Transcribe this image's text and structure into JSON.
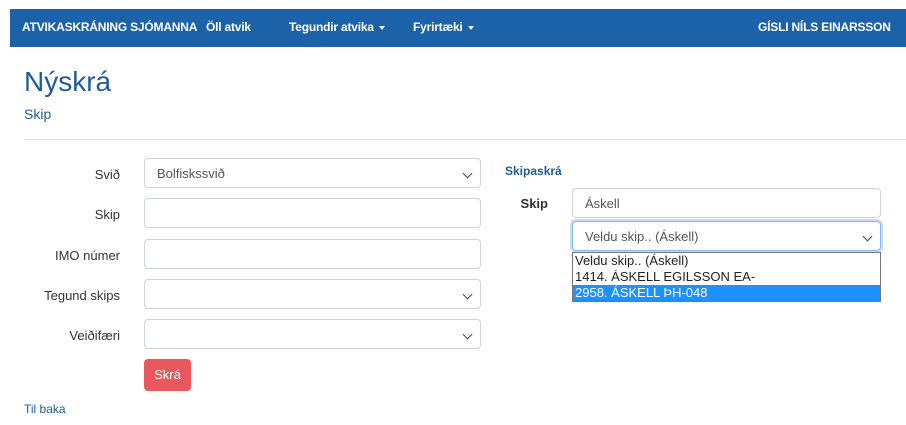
{
  "navbar": {
    "brand": "ATVIKASKRÁNING SJÓMANNA",
    "items": [
      "Öll atvik",
      "Tegundir atvika",
      "Fyrirtæki"
    ],
    "user": "GÍSLI NÍLS EINARSSON"
  },
  "page": {
    "title": "Nýskrá",
    "subtitle": "Skip"
  },
  "form": {
    "svid_label": "Svið",
    "svid_value": "Bolfiskssvið",
    "skip_label": "Skip",
    "skip_value": "",
    "imo_label": "IMO númer",
    "imo_value": "",
    "tegund_label": "Tegund skips",
    "tegund_value": "",
    "veidarfaeri_label": "Veiðifæri",
    "veidarfaeri_value": "",
    "submit": "Skrá"
  },
  "registry": {
    "heading": "Skipaskrá",
    "skip_label": "Skip",
    "search_value": "Áskell",
    "select_value": "Veldu skip.. (Áskell)",
    "options": [
      "Veldu skip.. (Áskell)",
      "1414. ÁSKELL EGILSSON EA-",
      "2958. ÁSKELL ÞH-048"
    ]
  },
  "back_link": "Til baka"
}
